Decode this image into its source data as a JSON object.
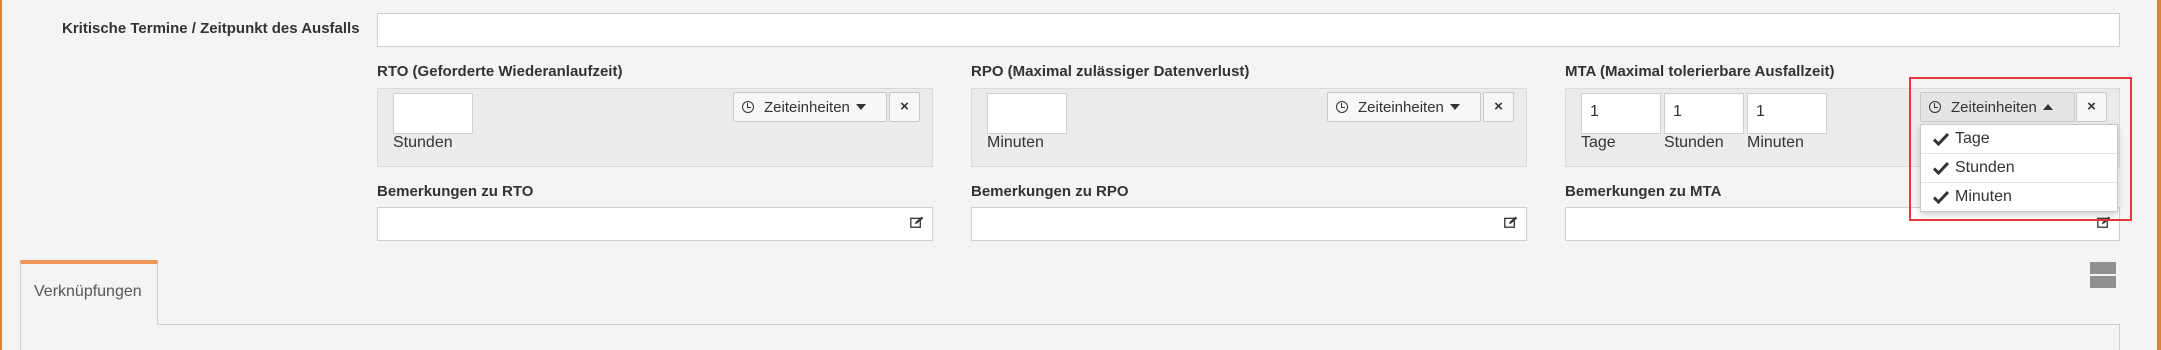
{
  "critical_dates": {
    "label": "Kritische Termine / Zeitpunkt des Ausfalls",
    "value": ""
  },
  "rto": {
    "label": "RTO (Geforderte Wiederanlaufzeit)",
    "fields": [
      {
        "value": "",
        "unit": "Stunden"
      }
    ],
    "timeunits_label": "Zeiteinheiten",
    "remove_label": "×",
    "remarks_label": "Bemerkungen zu RTO",
    "remarks_value": ""
  },
  "rpo": {
    "label": "RPO (Maximal zulässiger Datenverlust)",
    "fields": [
      {
        "value": "",
        "unit": "Minuten"
      }
    ],
    "timeunits_label": "Zeiteinheiten",
    "remove_label": "×",
    "remarks_label": "Bemerkungen zu RPO",
    "remarks_value": ""
  },
  "mta": {
    "label": "MTA (Maximal tolerierbare Ausfallzeit)",
    "fields": [
      {
        "value": "1",
        "unit": "Tage"
      },
      {
        "value": "1",
        "unit": "Stunden"
      },
      {
        "value": "1",
        "unit": "Minuten"
      }
    ],
    "timeunits_label": "Zeiteinheiten",
    "remove_label": "×",
    "remarks_label": "Bemerkungen zu MTA",
    "remarks_value": ""
  },
  "timeunit_menu": {
    "items": [
      {
        "label": "Tage",
        "checked": true
      },
      {
        "label": "Stunden",
        "checked": true
      },
      {
        "label": "Minuten",
        "checked": true
      }
    ]
  },
  "tabs": {
    "links": "Verknüpfungen"
  },
  "colors": {
    "accent": "#d9843b",
    "tab_accent": "#f0965b",
    "highlight": "#e0393e"
  }
}
